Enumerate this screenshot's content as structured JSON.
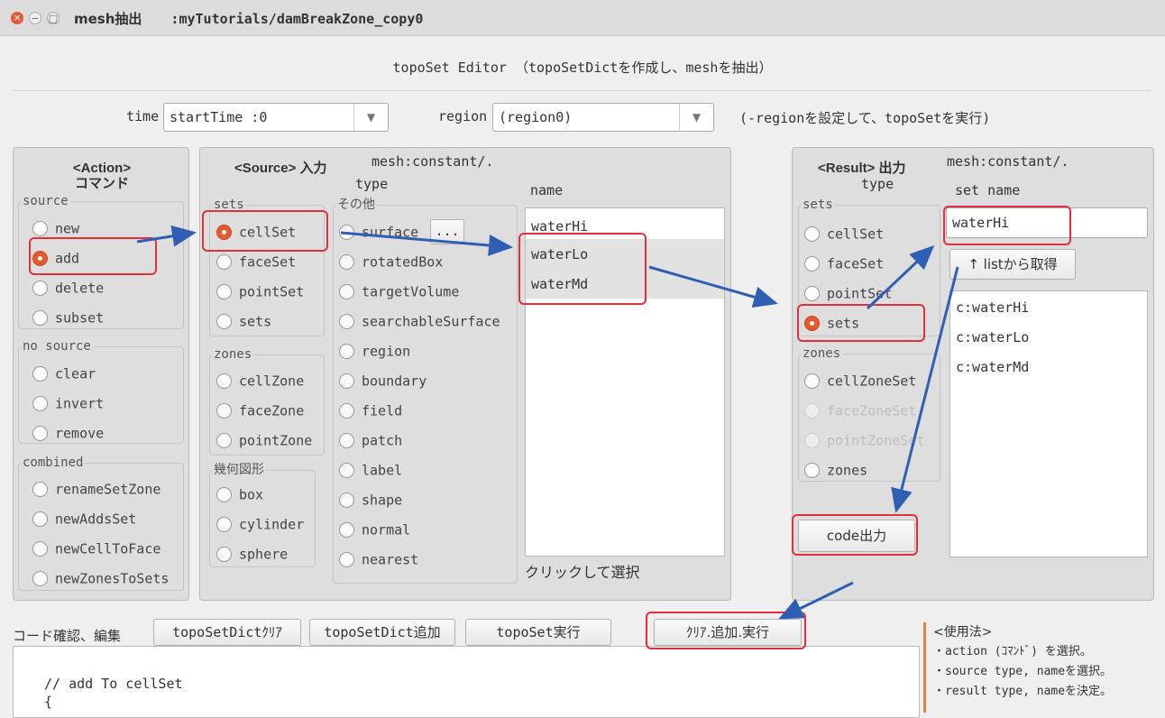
{
  "window": {
    "title": "mesh抽出",
    "path": ":myTutorials/damBreakZone_copy0",
    "close_glyph": "×",
    "min_glyph": "−",
    "max_glyph": "□"
  },
  "editor_title": "topoSet Editor （topoSetDictを作成し、meshを抽出）",
  "toolbar": {
    "time_label": "time",
    "time_value": "startTime :0",
    "region_label": "region",
    "region_value": "(region0)",
    "region_hint": "(-regionを設定して、topoSetを実行)",
    "dropdown_glyph": "▼"
  },
  "action": {
    "title": "<Action>",
    "subtitle": "コマンド",
    "source_group": "source",
    "source_items": [
      "new",
      "add",
      "delete",
      "subset"
    ],
    "source_selected": "add",
    "nosource_group": "no source",
    "nosource_items": [
      "clear",
      "invert",
      "remove"
    ],
    "combined_group": "combined",
    "combined_items": [
      "renameSetZone",
      "newAddsSet",
      "newCellToFace",
      "newZonesToSets"
    ]
  },
  "source": {
    "title": "<Source> 入力",
    "mesh_path": "mesh:constant/.",
    "type_label": "type",
    "name_label": "name",
    "sets_group": "sets",
    "sets_items": [
      "cellSet",
      "faceSet",
      "pointSet",
      "sets"
    ],
    "sets_selected": "cellSet",
    "zones_group": "zones",
    "zones_items": [
      "cellZone",
      "faceZone",
      "pointZone"
    ],
    "geometry_group": "幾何図形",
    "geometry_items": [
      "box",
      "cylinder",
      "sphere"
    ],
    "other_group": "その他",
    "other_items": [
      "surface",
      "rotatedBox",
      "targetVolume",
      "searchableSurface",
      "region",
      "boundary",
      "field",
      "patch",
      "label",
      "shape",
      "normal",
      "nearest"
    ],
    "surface_button": "...",
    "names": [
      "waterHi",
      "waterLo",
      "waterMd"
    ],
    "hint": "クリックして選択"
  },
  "result": {
    "title": "<Result> 出力",
    "mesh_path": "mesh:constant/.",
    "type_label": "type",
    "setname_label": "set name",
    "sets_group": "sets",
    "sets_items": [
      "cellSet",
      "faceSet",
      "pointSet",
      "sets"
    ],
    "sets_selected": "sets",
    "zones_group": "zones",
    "zones_items": [
      "cellZoneSet",
      "faceZoneSet",
      "pointZoneSet",
      "zones"
    ],
    "set_name_value": "waterHi",
    "list_button": "↑ listから取得",
    "list": [
      "c:waterHi",
      "c:waterLo",
      "c:waterMd"
    ],
    "code_button": "code出力"
  },
  "bottom": {
    "code_label": "コード確認、編集",
    "btn_clear": "topoSetDictｸﾘｱ",
    "btn_add": "topoSetDict追加",
    "btn_run": "topoSet実行",
    "btn_all": "ｸﾘｱ.追加.実行",
    "code_lines": [
      "// add To cellSet",
      "{"
    ],
    "usage_title": "<使用法>",
    "usage_lines": [
      "・action (ｺﾏﾝﾄﾞ) を選択。",
      "・source type, nameを選択。",
      "・result type, nameを決定。"
    ]
  },
  "colors": {
    "highlight": "#e0303c",
    "arrow": "#2f5fb4",
    "radio_selected": "#e65a2e"
  }
}
